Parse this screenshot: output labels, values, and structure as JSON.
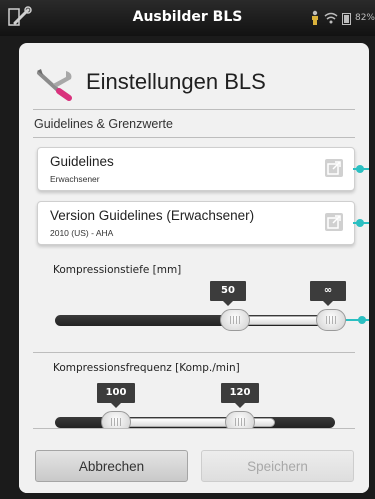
{
  "statusbar": {
    "title": "Ausbilder BLS",
    "battery_text": "82%"
  },
  "dialog": {
    "title": "Einstellungen BLS",
    "section_label": "Guidelines & Grenzwerte",
    "cards": [
      {
        "title": "Guidelines",
        "subtitle": "Erwachsener"
      },
      {
        "title": "Version Guidelines (Erwachsener)",
        "subtitle": "2010 (US) - AHA"
      }
    ],
    "depth_slider": {
      "label": "Kompressionstiefe [mm]",
      "min_value": "50",
      "max_value": "∞"
    },
    "rate_slider": {
      "label": "Kompressionsfrequenz [Komp./min]",
      "min_value": "100",
      "max_value": "120"
    },
    "buttons": {
      "cancel": "Abbrechen",
      "save": "Speichern"
    }
  },
  "colors": {
    "accent": "#2bbfc1",
    "tooltip": "#3c3c3c"
  }
}
